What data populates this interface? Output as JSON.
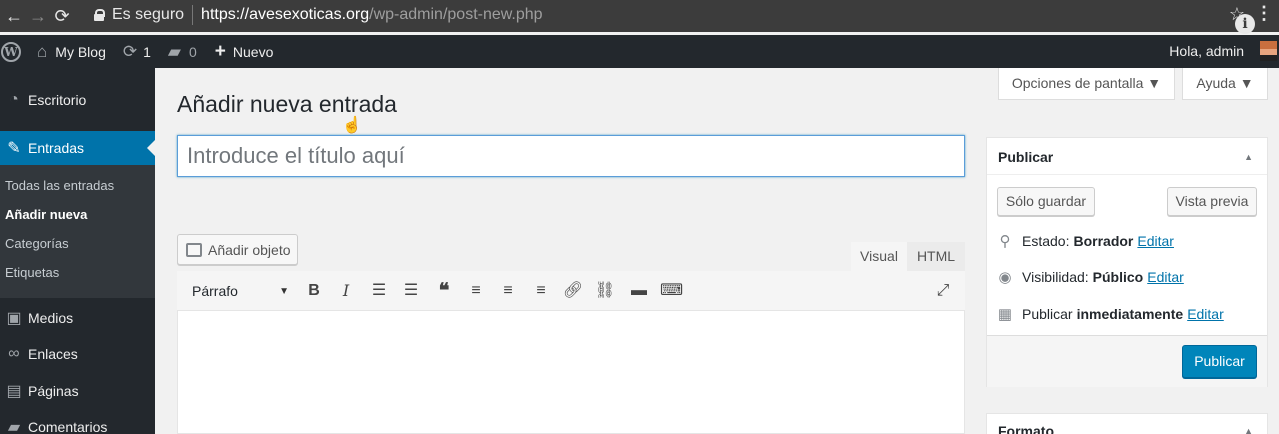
{
  "browser": {
    "back_icon": "arrow-left-icon",
    "secure_label": "Es seguro",
    "url_host": "https://avesexoticas.org",
    "url_path": "/wp-admin/post-new.php"
  },
  "admin_bar": {
    "site_name": "My Blog",
    "updates_count": "1",
    "comments_count": "0",
    "new_label": "Nuevo",
    "greeting": "Hola, admin"
  },
  "sidebar": {
    "items": [
      {
        "label": "Escritorio",
        "icon": "dashboard-icon"
      },
      {
        "label": "Entradas",
        "icon": "pin-icon"
      },
      {
        "label": "Medios",
        "icon": "media-icon"
      },
      {
        "label": "Enlaces",
        "icon": "link-icon"
      },
      {
        "label": "Páginas",
        "icon": "pages-icon"
      },
      {
        "label": "Comentarios",
        "icon": "comments-icon"
      }
    ],
    "submenu": [
      "Todas las entradas",
      "Añadir nueva",
      "Categorías",
      "Etiquetas"
    ]
  },
  "screen_options": {
    "label": "Opciones de pantalla ▼",
    "help": "Ayuda ▼"
  },
  "page": {
    "title": "Añadir nueva entrada",
    "title_placeholder": "Introduce el título aquí"
  },
  "editor": {
    "add_media": "Añadir objeto",
    "tab_visual": "Visual",
    "tab_html": "HTML",
    "format": "Párrafo"
  },
  "publish": {
    "title": "Publicar",
    "save_draft": "Sólo guardar",
    "preview": "Vista previa",
    "status_label": "Estado:",
    "status_value": "Borrador",
    "visibility_label": "Visibilidad:",
    "visibility_value": "Público",
    "schedule_label": "Publicar",
    "schedule_value": "inmediatamente",
    "edit": "Editar",
    "publish_button": "Publicar"
  },
  "format_box": {
    "title": "Formato"
  },
  "colors": {
    "admin_blue": "#0073aa",
    "primary_button": "#0085ba",
    "admin_dark": "#23282d"
  }
}
